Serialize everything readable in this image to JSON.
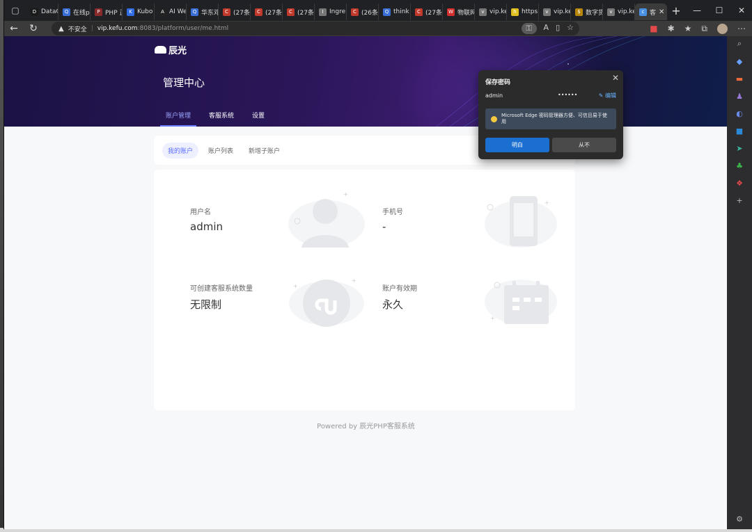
{
  "tabs": [
    {
      "label": "DataC",
      "color": "#1a1a1a",
      "icon": "D"
    },
    {
      "label": "在线p",
      "color": "#3a6fd8",
      "icon": "Q"
    },
    {
      "label": "PHP 正",
      "color": "#8a2a2a",
      "icon": "P"
    },
    {
      "label": "Kubo",
      "color": "#326ce5",
      "icon": "K"
    },
    {
      "label": "AI We",
      "color": "#222",
      "icon": "A"
    },
    {
      "label": "华东邓",
      "color": "#3a6fd8",
      "icon": "Q"
    },
    {
      "label": "(27条",
      "color": "#c0392b",
      "icon": "C"
    },
    {
      "label": "(27条",
      "color": "#c0392b",
      "icon": "C"
    },
    {
      "label": "(27条",
      "color": "#c0392b",
      "icon": "C"
    },
    {
      "label": "Ingre",
      "color": "#777",
      "icon": "I"
    },
    {
      "label": "(26条",
      "color": "#c0392b",
      "icon": "C"
    },
    {
      "label": "think",
      "color": "#3a6fd8",
      "icon": "Q"
    },
    {
      "label": "(27条",
      "color": "#c0392b",
      "icon": "C"
    },
    {
      "label": "物联网",
      "color": "#d32f2f",
      "icon": "W"
    },
    {
      "label": "vip.ke",
      "color": "#777",
      "icon": "v"
    },
    {
      "label": "https:",
      "color": "#e0c020",
      "icon": "h"
    },
    {
      "label": "vip.ke",
      "color": "#777",
      "icon": "v"
    },
    {
      "label": "数字货",
      "color": "#b8860b",
      "icon": "$"
    },
    {
      "label": "vip.ke",
      "color": "#777",
      "icon": "v"
    },
    {
      "label": "客",
      "color": "#4a90e2",
      "icon": "c",
      "active": true
    }
  ],
  "window_controls": {
    "minimize": "—",
    "maximize": "☐",
    "close": "✕"
  },
  "address": {
    "security_label": "不安全",
    "host": "vip.kefu.com",
    "path": ":8083/platform/user/me.html"
  },
  "site": {
    "logo_text": "辰光",
    "title": "管理中心",
    "nav": [
      "账户管理",
      "客服系统",
      "设置"
    ],
    "nav_active": "账户管理",
    "subnav": [
      "我的账户",
      "账户列表",
      "新增子账户"
    ],
    "subnav_active": "我的账户"
  },
  "account": {
    "username_label": "用户名",
    "username": "admin",
    "phone_label": "手机号",
    "phone": "-",
    "quota_label": "可创建客服系统数量",
    "quota": "无限制",
    "validity_label": "账户有效期",
    "validity": "永久"
  },
  "footer": "Powered by 辰光PHP客服系统",
  "password_popup": {
    "title": "保存密码",
    "username": "admin",
    "password_mask": "••••••",
    "edit_label": "编辑",
    "tip": "Microsoft Edge 密码管理器方便、可信且易于使用",
    "ok_label": "明白",
    "never_label": "从不"
  },
  "colors": {
    "accent": "#5b6cff",
    "popup_ok": "#1a6fd0",
    "hero_start": "#1b1244",
    "hero_end": "#0f1d4a"
  }
}
